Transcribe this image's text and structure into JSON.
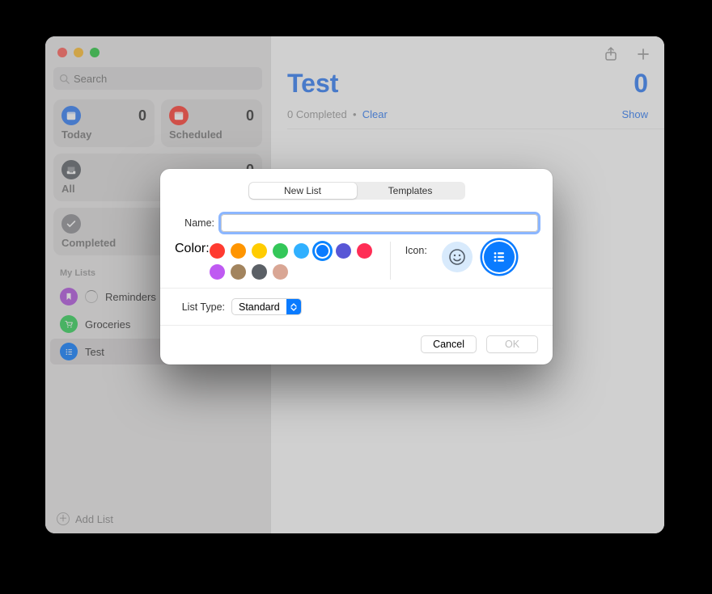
{
  "sidebar": {
    "search_placeholder": "Search",
    "cards": {
      "today": {
        "label": "Today",
        "count": "0",
        "color": "#2f7bf5"
      },
      "scheduled": {
        "label": "Scheduled",
        "count": "0",
        "color": "#ff3b30"
      },
      "all": {
        "label": "All",
        "count": "0",
        "color": "#5b6066"
      },
      "completed": {
        "label": "Completed",
        "color": "#8e8e93"
      }
    },
    "section_header": "My Lists",
    "lists": [
      {
        "name": "Reminders",
        "color": "#af52de"
      },
      {
        "name": "Groceries",
        "color": "#30d158"
      },
      {
        "name": "Test",
        "color": "#0a7bff"
      }
    ],
    "add_list_label": "Add List"
  },
  "main": {
    "title": "Test",
    "count": "0",
    "completed_text": "0 Completed",
    "bullet": "•",
    "clear_label": "Clear",
    "show_label": "Show"
  },
  "modal": {
    "tabs": {
      "new_list": "New List",
      "templates": "Templates"
    },
    "name_label": "Name:",
    "name_value": "",
    "color_label": "Color:",
    "colors": [
      "#ff3b30",
      "#ff9500",
      "#ffcc00",
      "#34c759",
      "#30b0ff",
      "#0a7bff",
      "#5856d6",
      "#ff2d55",
      "#bf5af2",
      "#a2845e",
      "#5b6066",
      "#d9a694"
    ],
    "selected_color_index": 5,
    "icon_label": "Icon:",
    "list_type_label": "List Type:",
    "list_type_value": "Standard",
    "cancel_label": "Cancel",
    "ok_label": "OK"
  }
}
